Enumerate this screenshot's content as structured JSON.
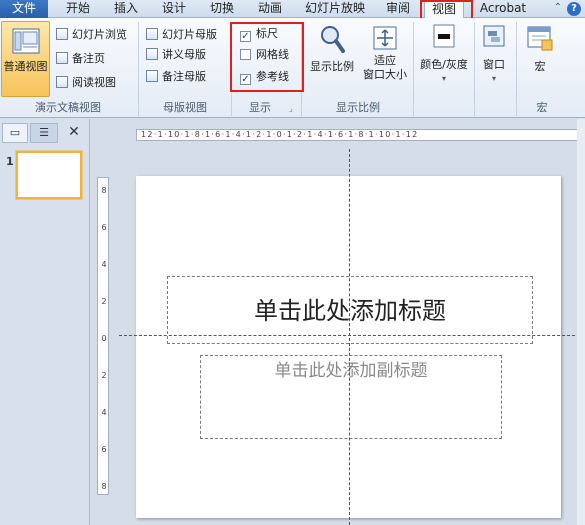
{
  "tabs": {
    "file": "文件",
    "home": "开始",
    "insert": "插入",
    "design": "设计",
    "transitions": "切换",
    "animations": "动画",
    "slideshow": "幻灯片放映",
    "review": "审阅",
    "view": "视图",
    "acrobat": "Acrobat"
  },
  "ribbon": {
    "presentation_views": {
      "normal": "普通视图",
      "slide_sorter": "幻灯片浏览",
      "notes_page": "备注页",
      "reading_view": "阅读视图",
      "group_label": "演示文稿视图"
    },
    "master_views": {
      "slide_master": "幻灯片母版",
      "handout_master": "讲义母版",
      "notes_master": "备注母版",
      "group_label": "母版视图"
    },
    "show": {
      "ruler": "标尺",
      "ruler_checked": true,
      "gridlines": "网格线",
      "gridlines_checked": false,
      "guides": "参考线",
      "guides_checked": true,
      "group_label": "显示"
    },
    "zoom": {
      "zoom": "显示比例",
      "fit_to_window": "适应\n窗口大小",
      "group_label": "显示比例"
    },
    "color": {
      "label": "颜色/灰度"
    },
    "window": {
      "label": "窗口"
    },
    "macros": {
      "label": "宏",
      "group_label": "宏"
    }
  },
  "left_pane": {
    "slide_number": "1"
  },
  "ruler": {
    "h_ticks": "12·1·10·1·8·1·6·1·4·1·2·1·0·1·2·1·4·1·6·1·8·1·10·1·12",
    "v_ticks": [
      "8",
      "6",
      "4",
      "2",
      "0",
      "2",
      "4",
      "6",
      "8"
    ]
  },
  "slide": {
    "title_placeholder": "单击此处添加标题",
    "subtitle_placeholder": "单击此处添加副标题"
  },
  "colors": {
    "highlight": "#e02020",
    "file_tab": "#2a5fa8",
    "selected_button": "#f6c45a"
  }
}
